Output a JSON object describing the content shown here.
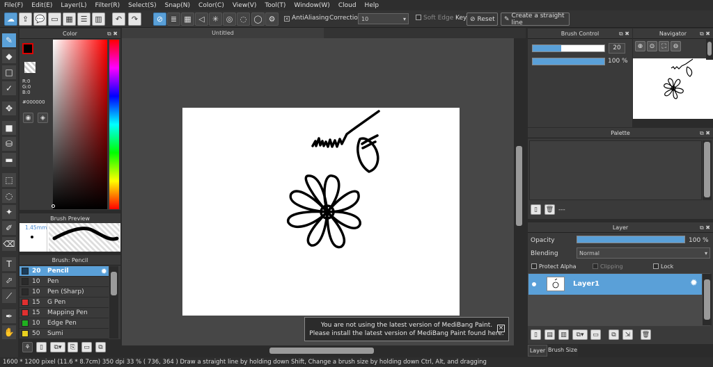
{
  "menu": [
    "File(F)",
    "Edit(E)",
    "Layer(L)",
    "Filter(R)",
    "Select(S)",
    "Snap(N)",
    "Color(C)",
    "View(V)",
    "Tool(T)",
    "Window(W)",
    "Cloud",
    "Help"
  ],
  "toolbar": {
    "antialiasing_label": "AntiAliasing",
    "antialiasing_checked": "×",
    "correction_label": "Correction",
    "correction_value": "10",
    "soft_edge_label": "Soft Edge",
    "key_label": "Key",
    "reset_label": "Reset",
    "straight_line_label": "Create a straight line"
  },
  "color_panel": {
    "title": "Color",
    "r": "R:0",
    "g": "G:0",
    "b": "B:0",
    "hex": "#000000",
    "current_color": "#000000"
  },
  "brush_preview": {
    "title": "Brush Preview",
    "size": "1.45mm"
  },
  "brush_list": {
    "title": "Brush: Pencil",
    "items": [
      {
        "size": "20",
        "name": "Pencil",
        "color": "#1a3d5c"
      },
      {
        "size": "10",
        "name": "Pen",
        "color": "#2a2a2a"
      },
      {
        "size": "10",
        "name": "Pen (Sharp)",
        "color": "#2a2a2a"
      },
      {
        "size": "15",
        "name": "G Pen",
        "color": "#e03030"
      },
      {
        "size": "15",
        "name": "Mapping Pen",
        "color": "#e03030"
      },
      {
        "size": "10",
        "name": "Edge Pen",
        "color": "#20b020"
      },
      {
        "size": "50",
        "name": "Sumi",
        "color": "#e8d020"
      }
    ]
  },
  "canvas": {
    "tab_title": "Untitled"
  },
  "notice": {
    "line1": "You are not using the latest version of MediBang Paint.",
    "line2": "Please install the latest version of MediBang Paint found here.",
    "close": "×"
  },
  "brush_control": {
    "title": "Brush Control",
    "size_value": "20",
    "size_fraction": 0.4,
    "opacity_value": "100 %",
    "opacity_fraction": 1.0
  },
  "navigator": {
    "title": "Navigator"
  },
  "palette": {
    "title": "Palette",
    "footer_text": "---"
  },
  "layer_panel": {
    "title": "Layer",
    "opacity_label": "Opacity",
    "opacity_value": "100 %",
    "opacity_fraction": 1.0,
    "blending_label": "Blending",
    "blending_value": "Normal",
    "protect_alpha_label": "Protect Alpha",
    "clipping_label": "Clipping",
    "lock_label": "Lock",
    "layers": [
      {
        "name": "Layer1"
      }
    ],
    "bottom_tabs": [
      "Layer",
      "Brush Size"
    ]
  },
  "status": {
    "text": "1600 * 1200 pixel   (11.6 * 8.7cm)   350 dpi   33 %   ( 736, 364 )   Draw a straight line by holding down Shift, Change a brush size by holding down Ctrl, Alt, and dragging"
  },
  "icons": [
    "cloud-icon",
    "export-icon",
    "chat-icon",
    "grid-icon",
    "undo-icon",
    "redo-icon",
    "gear-icon",
    "brush-icon",
    "eraser-icon",
    "move-icon",
    "fill-icon",
    "text-icon",
    "hand-icon",
    "eyedropper-icon",
    "zoom-in-icon",
    "zoom-out-icon",
    "fit-icon",
    "new-layer-icon",
    "trash-icon",
    "folder-icon"
  ]
}
